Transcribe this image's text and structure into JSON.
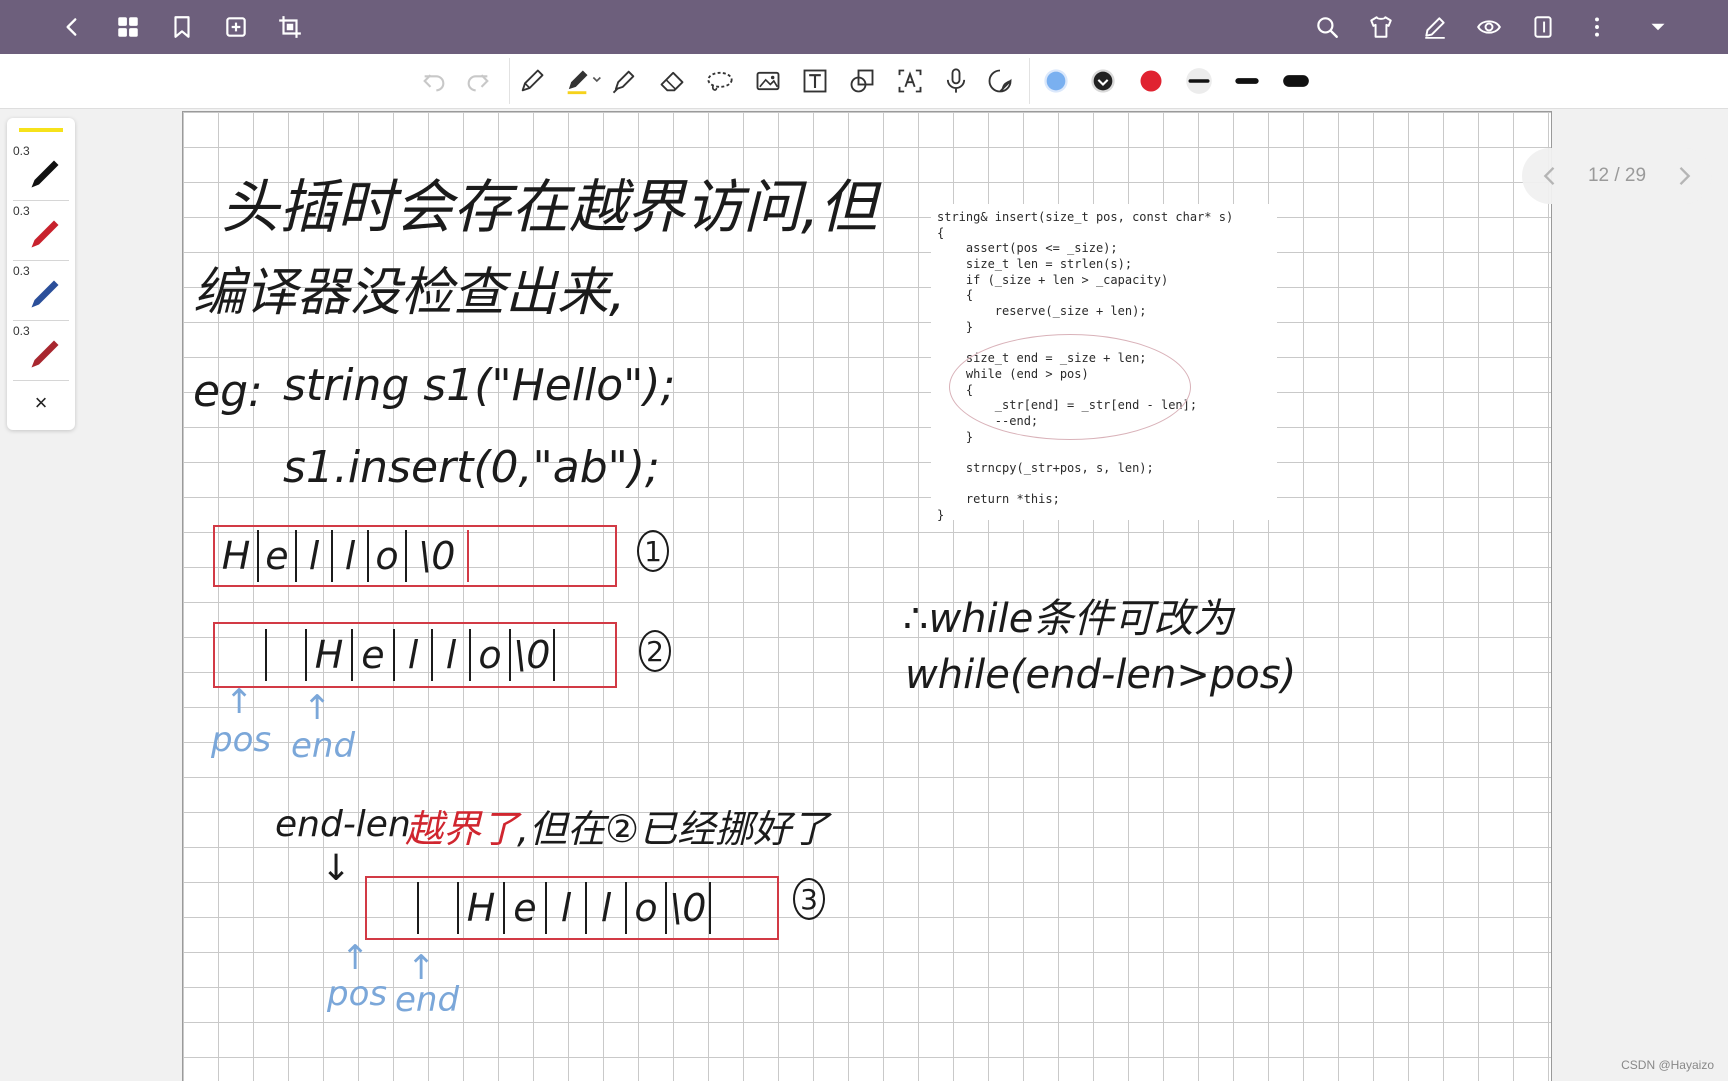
{
  "topbar": {
    "left_icons": [
      "back-icon",
      "grid-icon",
      "bookmark-icon",
      "add-page-icon",
      "crop-icon"
    ],
    "right_icons": [
      "search-icon",
      "shirt-icon",
      "pen-edit-icon",
      "eye-icon",
      "layout-icon",
      "more-icon",
      "dropdown-icon"
    ]
  },
  "toolbar": {
    "tools": [
      "undo-icon",
      "redo-icon",
      "pencil-icon",
      "pen-icon",
      "highlighter-icon",
      "eraser-icon",
      "lasso-icon",
      "image-icon",
      "text-icon",
      "shapes-icon",
      "ocr-icon",
      "mic-icon",
      "sticker-icon"
    ],
    "colors": [
      "#7ab0f0",
      "#222222",
      "#e02331"
    ],
    "stroke_widths": [
      "thin",
      "medium",
      "thick"
    ]
  },
  "pen_panel": {
    "highlight_color": "#f6e21b",
    "pens": [
      {
        "size": "0.3",
        "color": "#111111"
      },
      {
        "size": "0.3",
        "color": "#c8222d"
      },
      {
        "size": "0.3",
        "color": "#2b4f9a"
      },
      {
        "size": "0.3",
        "color": "#a8272f"
      }
    ],
    "close_label": "×"
  },
  "note": {
    "line1": "头插时会存在越界访问,但",
    "line2": "编译器没检查出来,",
    "eg_label": "eg:",
    "code1": "string s1(\"Hello\");",
    "code2": "s1.insert(0,\"ab\");",
    "array1": [
      "H",
      "e",
      "l",
      "l",
      "o",
      "\\0"
    ],
    "array2": [
      "",
      "",
      "H",
      "e",
      "l",
      "l",
      "o",
      "\\0"
    ],
    "array3": [
      "",
      "",
      "H",
      "e",
      "l",
      "l",
      "o",
      "\\0"
    ],
    "marker1": "1",
    "marker2": "2",
    "marker3": "3",
    "pos_label": "pos",
    "end_label": "end",
    "arrow_up": "↑",
    "arrow_down": "↓",
    "endlen_text": "end-len",
    "overflow_text": "越界了",
    "but_text": ",但在②已经挪好了",
    "conclusion1": "∴while条件可改为",
    "conclusion2": "while(end-len>pos)"
  },
  "code_snippet": [
    "string& insert(size_t pos, const char* s)",
    "{",
    "    assert(pos <= _size);",
    "    size_t len = strlen(s);",
    "    if (_size + len > _capacity)",
    "    {",
    "        reserve(_size + len);",
    "    }",
    "",
    "    size_t end = _size + len;",
    "    while (end > pos)",
    "    {",
    "        _str[end] = _str[end - len];",
    "        --end;",
    "    }",
    "",
    "    strncpy(_str+pos, s, len);",
    "",
    "    return *this;",
    "}"
  ],
  "pager": {
    "label": "12 / 29"
  },
  "watermark": "CSDN @Hayaizo"
}
